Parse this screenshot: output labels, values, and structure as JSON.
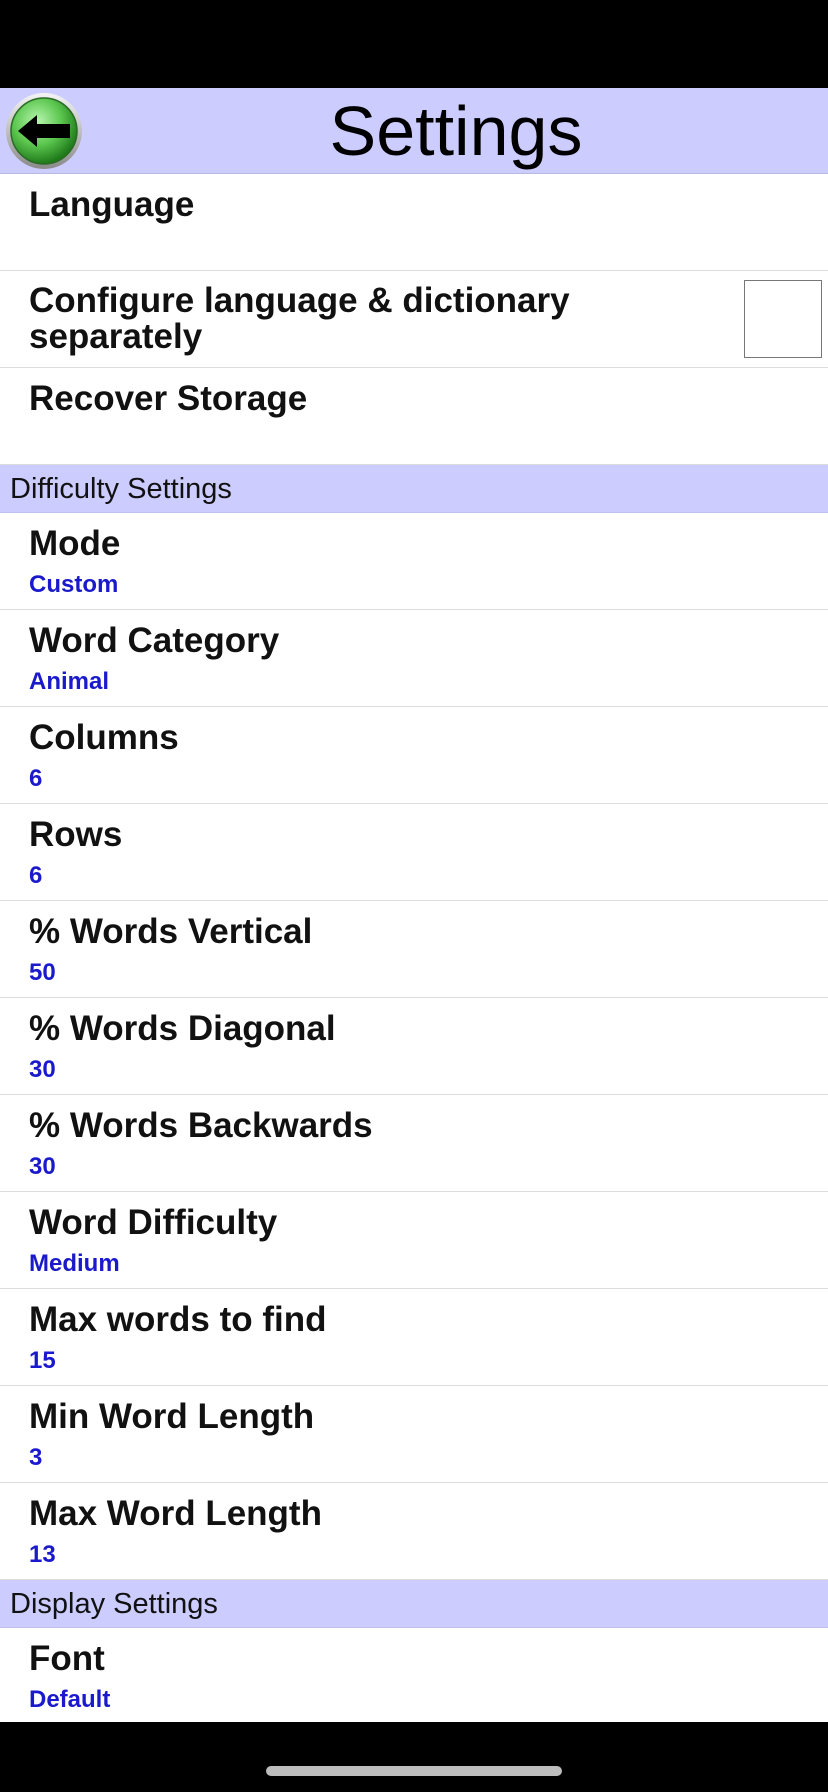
{
  "header": {
    "title": "Settings",
    "back_icon": "arrow-left-icon",
    "back_colors": {
      "ring": "#2f9a2a",
      "center": "#7fe07a",
      "arrow": "#000000"
    }
  },
  "general": {
    "language_label": "Language",
    "configure_label": "Configure language & dictionary separately",
    "configure_checked": false,
    "recover_label": "Recover Storage"
  },
  "difficulty": {
    "header": "Difficulty Settings",
    "items": [
      {
        "label": "Mode",
        "value": "Custom"
      },
      {
        "label": "Word Category",
        "value": "Animal"
      },
      {
        "label": "Columns",
        "value": "6"
      },
      {
        "label": "Rows",
        "value": "6"
      },
      {
        "label": "% Words Vertical",
        "value": "50"
      },
      {
        "label": "% Words Diagonal",
        "value": "30"
      },
      {
        "label": "% Words Backwards",
        "value": "30"
      },
      {
        "label": "Word Difficulty",
        "value": "Medium"
      },
      {
        "label": "Max words to find",
        "value": "15"
      },
      {
        "label": "Min Word Length",
        "value": "3"
      },
      {
        "label": "Max Word Length",
        "value": "13"
      }
    ]
  },
  "display": {
    "header": "Display Settings",
    "items": [
      {
        "label": "Font",
        "value": "Default"
      }
    ]
  },
  "colors": {
    "header_bg": "#cccdfe",
    "value_text": "#1a1acc"
  }
}
